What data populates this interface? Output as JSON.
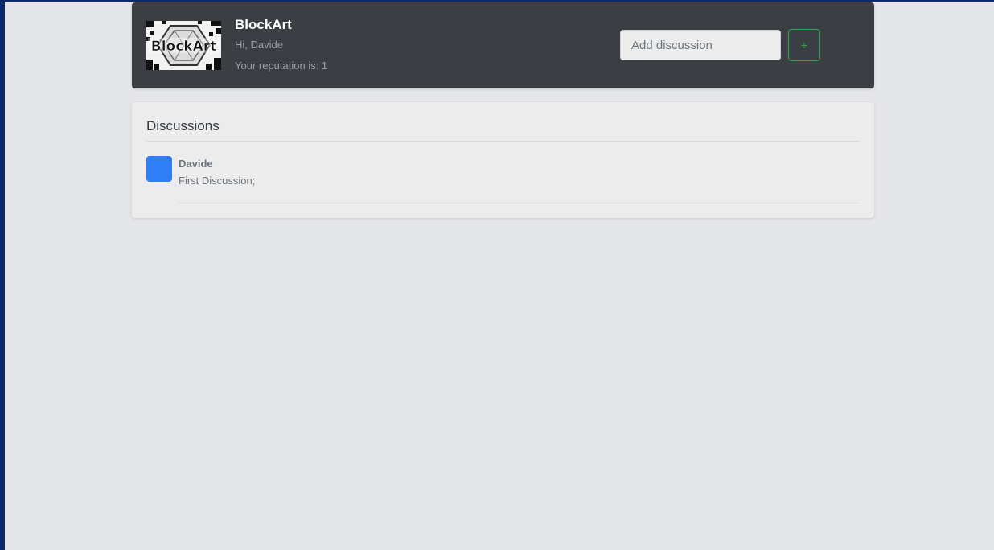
{
  "header": {
    "app_title": "BlockArt",
    "greeting": "Hi, Davide",
    "reputation": "Your reputation is: 1",
    "logo_text": "BlockArt",
    "add_placeholder": "Add discussion",
    "add_button_label": "+"
  },
  "discussions": {
    "title": "Discussions",
    "items": [
      {
        "author": "Davide",
        "message": "First Discussion;",
        "avatar_color": "#2f7ef7"
      }
    ]
  },
  "colors": {
    "header_bg": "#3b3f43",
    "accent_green": "#28a745",
    "page_bg": "#e5e6ea",
    "frame_blue": "#0b2a6b"
  }
}
